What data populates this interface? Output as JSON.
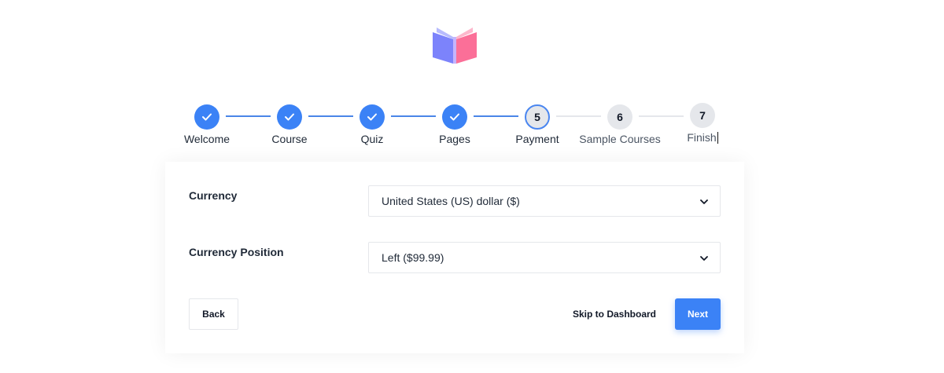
{
  "app": {
    "logo_icon": "open-book-icon"
  },
  "colors": {
    "accent": "#3b82f6",
    "logo_left": "#7c83fb",
    "logo_right": "#fb6f98",
    "pending": "#e5e7eb"
  },
  "stepper": {
    "steps": [
      {
        "number": "1",
        "label": "Welcome",
        "status": "done"
      },
      {
        "number": "2",
        "label": "Course",
        "status": "done"
      },
      {
        "number": "3",
        "label": "Quiz",
        "status": "done"
      },
      {
        "number": "4",
        "label": "Pages",
        "status": "done"
      },
      {
        "number": "5",
        "label": "Payment",
        "status": "current"
      },
      {
        "number": "6",
        "label": "Sample Courses",
        "status": "todo"
      },
      {
        "number": "7",
        "label": "Finish",
        "status": "todo"
      }
    ]
  },
  "form": {
    "currency": {
      "label": "Currency",
      "value": "United States (US) dollar ($)"
    },
    "position": {
      "label": "Currency Position",
      "value": "Left ($99.99)"
    }
  },
  "actions": {
    "back": "Back",
    "skip": "Skip to Dashboard",
    "next": "Next"
  }
}
